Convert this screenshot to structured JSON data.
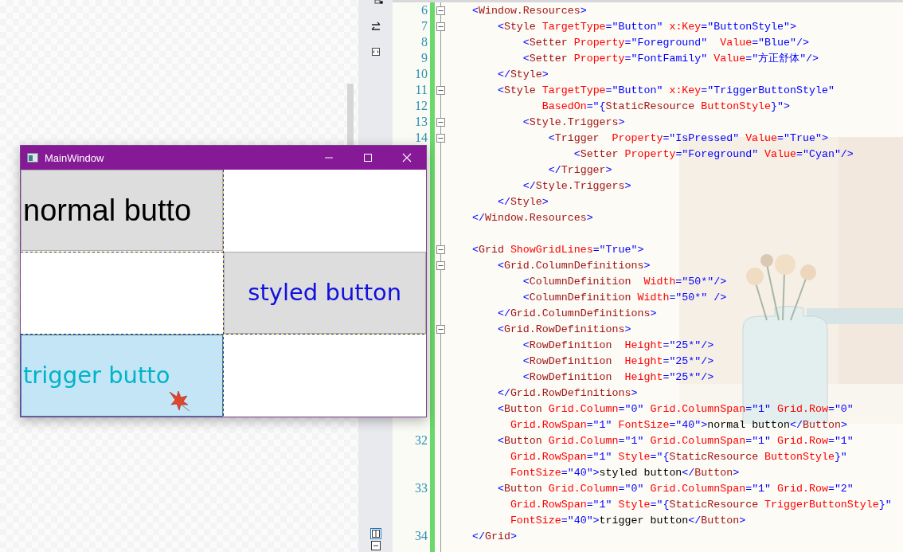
{
  "window": {
    "title": "MainWindow",
    "grid": [
      {
        "cells": [
          {
            "kind": "normal",
            "label": "normal butto",
            "hovered": false
          },
          {
            "kind": "empty"
          }
        ]
      },
      {
        "cells": [
          {
            "kind": "empty"
          },
          {
            "kind": "styled",
            "label": "styled button",
            "hovered": false
          }
        ]
      },
      {
        "cells": [
          {
            "kind": "trigger",
            "label": "trigger butto",
            "hovered": true
          },
          {
            "kind": "empty"
          }
        ]
      }
    ]
  },
  "editor": {
    "lines": [
      {
        "number": "6",
        "expanded": true,
        "segments": [
          {
            "kind": "punct",
            "text": "<"
          },
          {
            "kind": "tag",
            "text": "Window.Resources"
          },
          {
            "kind": "punct",
            "text": ">"
          }
        ]
      },
      {
        "number": "7",
        "expanded": true,
        "segments": [
          {
            "kind": "punct",
            "text": "    <"
          },
          {
            "kind": "tag",
            "text": "Style"
          },
          {
            "kind": "attr",
            "text": " TargetType"
          },
          {
            "kind": "punct",
            "text": "=\"Button\""
          },
          {
            "kind": "attr",
            "text": " x:Key"
          },
          {
            "kind": "punct",
            "text": "=\"ButtonStyle\">"
          }
        ]
      },
      {
        "number": "8",
        "segments": [
          {
            "kind": "punct",
            "text": "        <"
          },
          {
            "kind": "tag",
            "text": "Setter"
          },
          {
            "kind": "attr",
            "text": " Property"
          },
          {
            "kind": "punct",
            "text": "=\"Foreground\""
          },
          {
            "kind": "attr",
            "text": "  Value"
          },
          {
            "kind": "punct",
            "text": "=\"Blue\"/>"
          }
        ]
      },
      {
        "number": "9",
        "segments": [
          {
            "kind": "punct",
            "text": "        <"
          },
          {
            "kind": "tag",
            "text": "Setter"
          },
          {
            "kind": "attr",
            "text": " Property"
          },
          {
            "kind": "punct",
            "text": "=\"FontFamily\""
          },
          {
            "kind": "attr",
            "text": " Value"
          },
          {
            "kind": "punct",
            "text": "=\"方正舒体\"/>"
          }
        ]
      },
      {
        "number": "10",
        "segments": [
          {
            "kind": "punct",
            "text": "    </"
          },
          {
            "kind": "tag",
            "text": "Style"
          },
          {
            "kind": "punct",
            "text": ">"
          }
        ]
      },
      {
        "number": "11",
        "expanded": true,
        "segments": [
          {
            "kind": "punct",
            "text": "    <"
          },
          {
            "kind": "tag",
            "text": "Style"
          },
          {
            "kind": "attr",
            "text": " TargetType"
          },
          {
            "kind": "punct",
            "text": "=\"Button\""
          },
          {
            "kind": "attr",
            "text": " x:Key"
          },
          {
            "kind": "punct",
            "text": "=\"TriggerButtonStyle\""
          }
        ]
      },
      {
        "number": "12",
        "segments": [
          {
            "kind": "attr",
            "text": "           BasedOn"
          },
          {
            "kind": "punct",
            "text": "=\"{"
          },
          {
            "kind": "tag",
            "text": "StaticResource"
          },
          {
            "kind": "attr",
            "text": " ButtonStyle"
          },
          {
            "kind": "punct",
            "text": "}\">"
          }
        ]
      },
      {
        "number": "13",
        "expanded": true,
        "segments": [
          {
            "kind": "punct",
            "text": "        <"
          },
          {
            "kind": "tag",
            "text": "Style.Triggers"
          },
          {
            "kind": "punct",
            "text": ">"
          }
        ]
      },
      {
        "number": "14",
        "expanded": true,
        "segments": [
          {
            "kind": "punct",
            "text": "            <"
          },
          {
            "kind": "tag",
            "text": "Trigger"
          },
          {
            "kind": "attr",
            "text": "  Property"
          },
          {
            "kind": "punct",
            "text": "=\"IsPressed\""
          },
          {
            "kind": "attr",
            "text": " Value"
          },
          {
            "kind": "punct",
            "text": "=\"True\">"
          }
        ]
      },
      {
        "segments": [
          {
            "kind": "punct",
            "text": "                <"
          },
          {
            "kind": "tag",
            "text": "Setter"
          },
          {
            "kind": "attr",
            "text": " Property"
          },
          {
            "kind": "punct",
            "text": "=\"Foreground\""
          },
          {
            "kind": "attr",
            "text": " Value"
          },
          {
            "kind": "punct",
            "text": "=\"Cyan\"/>"
          }
        ]
      },
      {
        "segments": [
          {
            "kind": "punct",
            "text": "            </"
          },
          {
            "kind": "tag",
            "text": "Trigger"
          },
          {
            "kind": "punct",
            "text": ">"
          }
        ]
      },
      {
        "segments": [
          {
            "kind": "punct",
            "text": "        </"
          },
          {
            "kind": "tag",
            "text": "Style.Triggers"
          },
          {
            "kind": "punct",
            "text": ">"
          }
        ]
      },
      {
        "segments": [
          {
            "kind": "punct",
            "text": "    </"
          },
          {
            "kind": "tag",
            "text": "Style"
          },
          {
            "kind": "punct",
            "text": ">"
          }
        ]
      },
      {
        "segments": [
          {
            "kind": "punct",
            "text": "</"
          },
          {
            "kind": "tag",
            "text": "Window.Resources"
          },
          {
            "kind": "punct",
            "text": ">"
          }
        ]
      },
      {
        "blank_before": true,
        "expanded": true,
        "segments": [
          {
            "kind": "punct",
            "text": "<"
          },
          {
            "kind": "tag",
            "text": "Grid"
          },
          {
            "kind": "attr",
            "text": " ShowGridLines"
          },
          {
            "kind": "punct",
            "text": "=\"True\">"
          }
        ]
      },
      {
        "expanded": true,
        "segments": [
          {
            "kind": "punct",
            "text": "    <"
          },
          {
            "kind": "tag",
            "text": "Grid.ColumnDefinitions"
          },
          {
            "kind": "punct",
            "text": ">"
          }
        ]
      },
      {
        "segments": [
          {
            "kind": "punct",
            "text": "        <"
          },
          {
            "kind": "tag",
            "text": "ColumnDefinition"
          },
          {
            "kind": "attr",
            "text": "  Width"
          },
          {
            "kind": "punct",
            "text": "=\"50*\"/>"
          }
        ]
      },
      {
        "segments": [
          {
            "kind": "punct",
            "text": "        <"
          },
          {
            "kind": "tag",
            "text": "ColumnDefinition"
          },
          {
            "kind": "attr",
            "text": " Width"
          },
          {
            "kind": "punct",
            "text": "=\"50*\" />"
          }
        ]
      },
      {
        "segments": [
          {
            "kind": "punct",
            "text": "    </"
          },
          {
            "kind": "tag",
            "text": "Grid.ColumnDefinitions"
          },
          {
            "kind": "punct",
            "text": ">"
          }
        ]
      },
      {
        "expanded": true,
        "segments": [
          {
            "kind": "punct",
            "text": "    <"
          },
          {
            "kind": "tag",
            "text": "Grid.RowDefinitions"
          },
          {
            "kind": "punct",
            "text": ">"
          }
        ]
      },
      {
        "segments": [
          {
            "kind": "punct",
            "text": "        <"
          },
          {
            "kind": "tag",
            "text": "RowDefinition"
          },
          {
            "kind": "attr",
            "text": "  Height"
          },
          {
            "kind": "punct",
            "text": "=\"25*\"/>"
          }
        ]
      },
      {
        "segments": [
          {
            "kind": "punct",
            "text": "        <"
          },
          {
            "kind": "tag",
            "text": "RowDefinition"
          },
          {
            "kind": "attr",
            "text": "  Height"
          },
          {
            "kind": "punct",
            "text": "=\"25*\"/>"
          }
        ]
      },
      {
        "segments": [
          {
            "kind": "punct",
            "text": "        <"
          },
          {
            "kind": "tag",
            "text": "RowDefinition"
          },
          {
            "kind": "attr",
            "text": "  Height"
          },
          {
            "kind": "punct",
            "text": "=\"25*\"/>"
          }
        ]
      },
      {
        "segments": [
          {
            "kind": "punct",
            "text": "    </"
          },
          {
            "kind": "tag",
            "text": "Grid.RowDefinitions"
          },
          {
            "kind": "punct",
            "text": ">"
          }
        ]
      },
      {
        "segments": [
          {
            "kind": "punct",
            "text": "    <"
          },
          {
            "kind": "tag",
            "text": "Button"
          },
          {
            "kind": "attr",
            "text": " Grid.Column"
          },
          {
            "kind": "punct",
            "text": "=\"0\""
          },
          {
            "kind": "attr",
            "text": " Grid.ColumnSpan"
          },
          {
            "kind": "punct",
            "text": "=\"1\""
          },
          {
            "kind": "attr",
            "text": " Grid.Row"
          },
          {
            "kind": "punct",
            "text": "=\"0\""
          }
        ]
      },
      {
        "segments": [
          {
            "kind": "attr",
            "text": "      Grid.RowSpan"
          },
          {
            "kind": "punct",
            "text": "=\"1\""
          },
          {
            "kind": "attr",
            "text": " FontSize"
          },
          {
            "kind": "punct",
            "text": "=\"40\">"
          },
          {
            "kind": "text",
            "text": "normal button"
          },
          {
            "kind": "punct",
            "text": "</"
          },
          {
            "kind": "tag",
            "text": "Button"
          },
          {
            "kind": "punct",
            "text": ">"
          }
        ]
      },
      {
        "number": "32",
        "segments": [
          {
            "kind": "punct",
            "text": "    <"
          },
          {
            "kind": "tag",
            "text": "Button"
          },
          {
            "kind": "attr",
            "text": " Grid.Column"
          },
          {
            "kind": "punct",
            "text": "=\"1\""
          },
          {
            "kind": "attr",
            "text": " Grid.ColumnSpan"
          },
          {
            "kind": "punct",
            "text": "=\"1\""
          },
          {
            "kind": "attr",
            "text": " Grid.Row"
          },
          {
            "kind": "punct",
            "text": "=\"1\""
          }
        ]
      },
      {
        "segments": [
          {
            "kind": "attr",
            "text": "      Grid.RowSpan"
          },
          {
            "kind": "punct",
            "text": "=\"1\""
          },
          {
            "kind": "attr",
            "text": " Style"
          },
          {
            "kind": "punct",
            "text": "=\"{"
          },
          {
            "kind": "tag",
            "text": "StaticResource"
          },
          {
            "kind": "attr",
            "text": " ButtonStyle"
          },
          {
            "kind": "punct",
            "text": "}\""
          }
        ]
      },
      {
        "segments": [
          {
            "kind": "attr",
            "text": "      FontSize"
          },
          {
            "kind": "punct",
            "text": "=\"40\">"
          },
          {
            "kind": "text",
            "text": "styled button"
          },
          {
            "kind": "punct",
            "text": "</"
          },
          {
            "kind": "tag",
            "text": "Button"
          },
          {
            "kind": "punct",
            "text": ">"
          }
        ]
      },
      {
        "number": "33",
        "segments": [
          {
            "kind": "punct",
            "text": "    <"
          },
          {
            "kind": "tag",
            "text": "Button"
          },
          {
            "kind": "attr",
            "text": " Grid.Column"
          },
          {
            "kind": "punct",
            "text": "=\"0\""
          },
          {
            "kind": "attr",
            "text": " Grid.ColumnSpan"
          },
          {
            "kind": "punct",
            "text": "=\"1\""
          },
          {
            "kind": "attr",
            "text": " Grid.Row"
          },
          {
            "kind": "punct",
            "text": "=\"2\""
          }
        ]
      },
      {
        "segments": [
          {
            "kind": "attr",
            "text": "      Grid.RowSpan"
          },
          {
            "kind": "punct",
            "text": "=\"1\""
          },
          {
            "kind": "attr",
            "text": " Style"
          },
          {
            "kind": "punct",
            "text": "=\"{"
          },
          {
            "kind": "tag",
            "text": "StaticResource"
          },
          {
            "kind": "attr",
            "text": " TriggerButtonStyle"
          },
          {
            "kind": "punct",
            "text": "}\""
          }
        ]
      },
      {
        "segments": [
          {
            "kind": "attr",
            "text": "      FontSize"
          },
          {
            "kind": "punct",
            "text": "=\"40\">"
          },
          {
            "kind": "text",
            "text": "trigger button"
          },
          {
            "kind": "punct",
            "text": "</"
          },
          {
            "kind": "tag",
            "text": "Button"
          },
          {
            "kind": "punct",
            "text": ">"
          }
        ]
      },
      {
        "number": "34",
        "segments": [
          {
            "kind": "punct",
            "text": "</"
          },
          {
            "kind": "tag",
            "text": "Grid"
          },
          {
            "kind": "punct",
            "text": ">"
          }
        ]
      }
    ]
  }
}
